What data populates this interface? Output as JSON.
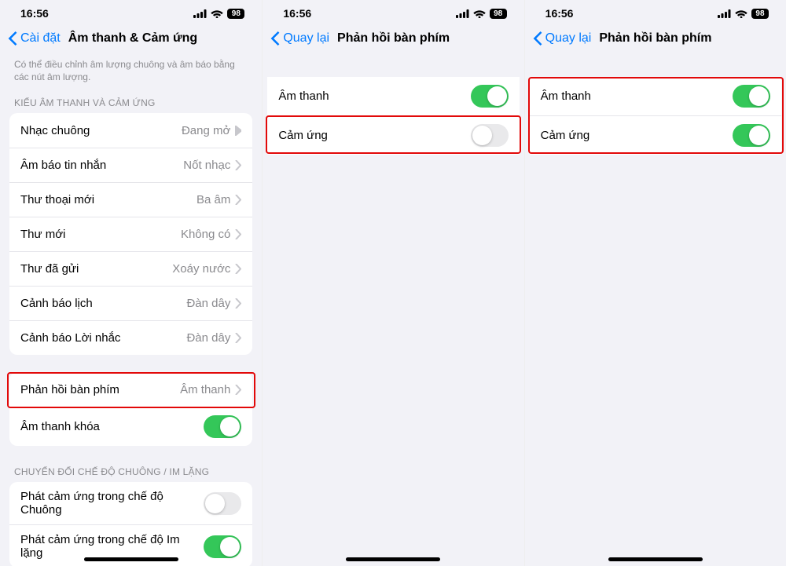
{
  "status": {
    "time": "16:56",
    "battery": "98"
  },
  "p1": {
    "back": "Cài đặt",
    "title": "Âm thanh & Cảm ứng",
    "hint": "Có thể điều chỉnh âm lượng chuông và âm báo bằng các nút âm lượng.",
    "section1": "KIỂU ÂM THANH VÀ CẢM ỨNG",
    "rows1": [
      {
        "label": "Nhạc chuông",
        "value": "Đang mở"
      },
      {
        "label": "Âm báo tin nhắn",
        "value": "Nốt nhạc"
      },
      {
        "label": "Thư thoại mới",
        "value": "Ba âm"
      },
      {
        "label": "Thư mới",
        "value": "Không có"
      },
      {
        "label": "Thư đã gửi",
        "value": "Xoáy nước"
      },
      {
        "label": "Cảnh báo lịch",
        "value": "Đàn dây"
      },
      {
        "label": "Cảnh báo Lời nhắc",
        "value": "Đàn dây"
      }
    ],
    "rows2": [
      {
        "label": "Phản hồi bàn phím",
        "value": "Âm thanh"
      },
      {
        "label": "Âm thanh khóa",
        "toggle": true,
        "on": true
      }
    ],
    "section3": "CHUYỂN ĐỔI CHẾ ĐỘ CHUÔNG / IM LẶNG",
    "rows3": [
      {
        "label": "Phát cảm ứng trong chế độ Chuông",
        "toggle": true,
        "on": false
      },
      {
        "label": "Phát cảm ứng trong chế độ Im lặng",
        "toggle": true,
        "on": true
      }
    ]
  },
  "p2": {
    "back": "Quay lại",
    "title": "Phản hồi bàn phím",
    "rows": [
      {
        "label": "Âm thanh",
        "on": true
      },
      {
        "label": "Cảm ứng",
        "on": false
      }
    ]
  },
  "p3": {
    "back": "Quay lại",
    "title": "Phản hồi bàn phím",
    "rows": [
      {
        "label": "Âm thanh",
        "on": true
      },
      {
        "label": "Cảm ứng",
        "on": true
      }
    ]
  }
}
